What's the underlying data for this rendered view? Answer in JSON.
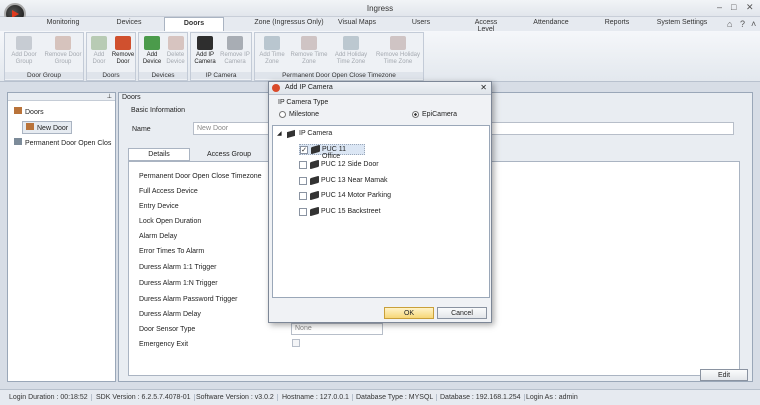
{
  "window": {
    "title": "Ingress"
  },
  "tabs": [
    "Monitoring",
    "Devices",
    "Doors",
    "Zone (Ingressus Only)",
    "Visual Maps",
    "Users",
    "Access Level",
    "Attendance",
    "Reports",
    "System Settings"
  ],
  "ribbon": {
    "door_group": {
      "label": "Door Group",
      "add": "Add Door Group",
      "remove": "Remove Door Group"
    },
    "doors": {
      "label": "Doors",
      "add": "Add Door",
      "remove": "Remove Door"
    },
    "devices": {
      "label": "Devices",
      "add": "Add Device",
      "delete": "Delete Device"
    },
    "ip_camera": {
      "label": "IP Camera",
      "add": "Add IP Camera",
      "remove": "Remove IP Camera"
    },
    "timezone": {
      "label": "Permanent Door Open Close Timezone",
      "add_time": "Add Time Zone",
      "remove_time": "Remove Time Zone",
      "add_holiday": "Add Holiday Time Zone",
      "remove_holiday": "Remove Holiday Time Zone"
    }
  },
  "tree": {
    "root": "Doors",
    "child": "New Door",
    "other": "Permanent Door Open Clos"
  },
  "main": {
    "header": "Doors",
    "section": "Basic Information",
    "name_label": "Name",
    "name_placeholder": "New Door",
    "tab_details": "Details",
    "tab_access": "Access Group",
    "fields": [
      "Permanent Door Open Close Timezone",
      "Full Access Device",
      "Entry Device",
      "Lock Open Duration",
      "Alarm Delay",
      "Error Times To Alarm",
      "Duress Alarm 1:1 Trigger",
      "Duress Alarm 1:N Trigger",
      "Duress Alarm Password Trigger",
      "Duress Alarm Delay",
      "Door Sensor Type",
      "Emergency Exit"
    ],
    "sensor_value": "None",
    "edit_button": "Edit"
  },
  "dialog": {
    "title": "Add IP Camera",
    "type_label": "IP Camera Type",
    "opt_milestone": "Milestone",
    "opt_epicamera": "EpiCamera",
    "selected": "EpiCamera",
    "tree_root": "IP Camera",
    "cameras": [
      {
        "name": "PUC 11 Office",
        "checked": true
      },
      {
        "name": "PUC 12 Side Door",
        "checked": false
      },
      {
        "name": "PUC 13 Near Mamak",
        "checked": false
      },
      {
        "name": "PUC 14 Motor Parking",
        "checked": false
      },
      {
        "name": "PUC 15 Backstreet",
        "checked": false
      }
    ],
    "ok": "OK",
    "cancel": "Cancel"
  },
  "status": {
    "login_duration": "Login Duration : 00:18:52",
    "sdk": "SDK Version : 6.2.5.7.4078-01",
    "software": "Software Version : v3.0.2",
    "hostname": "Hostname : 127.0.0.1",
    "db_type": "Database Type : MYSQL",
    "database": "Database : 192.168.1.254",
    "login_as": "Login As : admin"
  }
}
